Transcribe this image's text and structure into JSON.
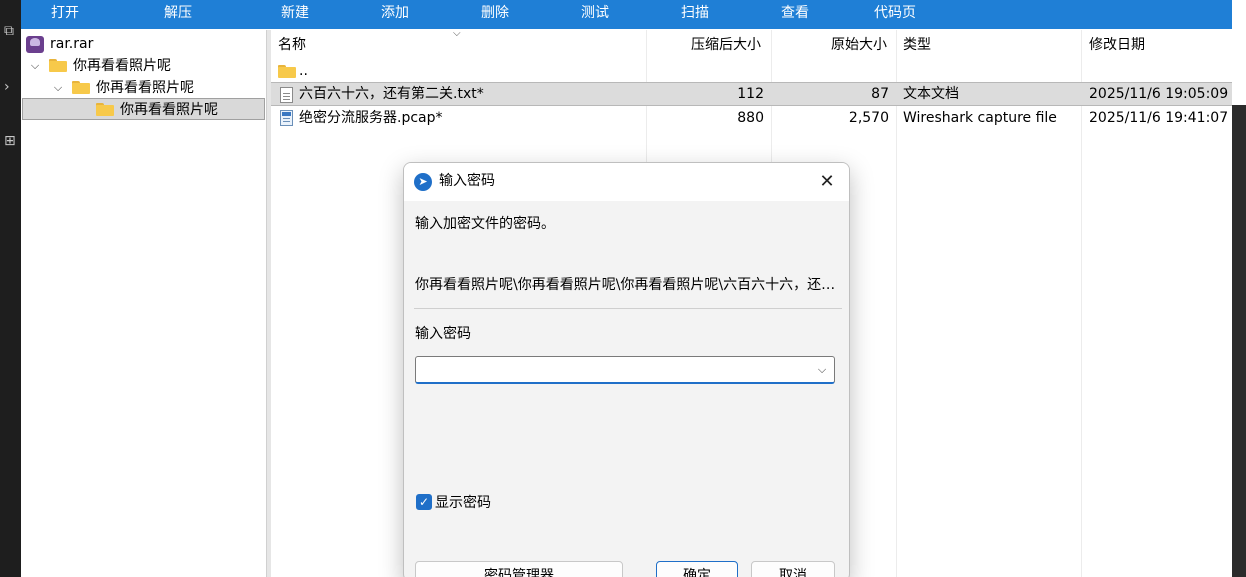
{
  "toolbar": {
    "items": [
      "打开",
      "解压",
      "新建",
      "添加",
      "删除",
      "测试",
      "扫描",
      "查看",
      "代码页"
    ]
  },
  "tree": {
    "root": "rar.rar",
    "level1": "你再看看照片呢",
    "level2": "你再看看照片呢",
    "level3": "你再看看照片呢"
  },
  "list": {
    "columns": {
      "name": "名称",
      "packed": "压缩后大小",
      "size": "原始大小",
      "type": "类型",
      "modified": "修改日期"
    },
    "up": "..",
    "files": [
      {
        "name": "六百六十六，还有第二关.txt*",
        "packed": "112",
        "size": "87",
        "type": "文本文档",
        "modified": "2025/11/6 19:05:09"
      },
      {
        "name": "绝密分流服务器.pcap*",
        "packed": "880",
        "size": "2,570",
        "type": "Wireshark capture file",
        "modified": "2025/11/6 19:41:07"
      }
    ]
  },
  "dialog": {
    "title": "输入密码",
    "prompt": "输入加密文件的密码。",
    "path": "你再看看照片呢\\你再看看照片呢\\你再看看照片呢\\六百六十六，还有第二关.txt",
    "field_label": "输入密码",
    "password_value": "",
    "show_password": "显示密码",
    "btn_manager": "密码管理器",
    "btn_ok": "确定",
    "btn_cancel": "取消"
  },
  "colors": {
    "toolbar": "#1f7fd6",
    "accent": "#1f6fc8",
    "folder": "#f7c94a"
  }
}
